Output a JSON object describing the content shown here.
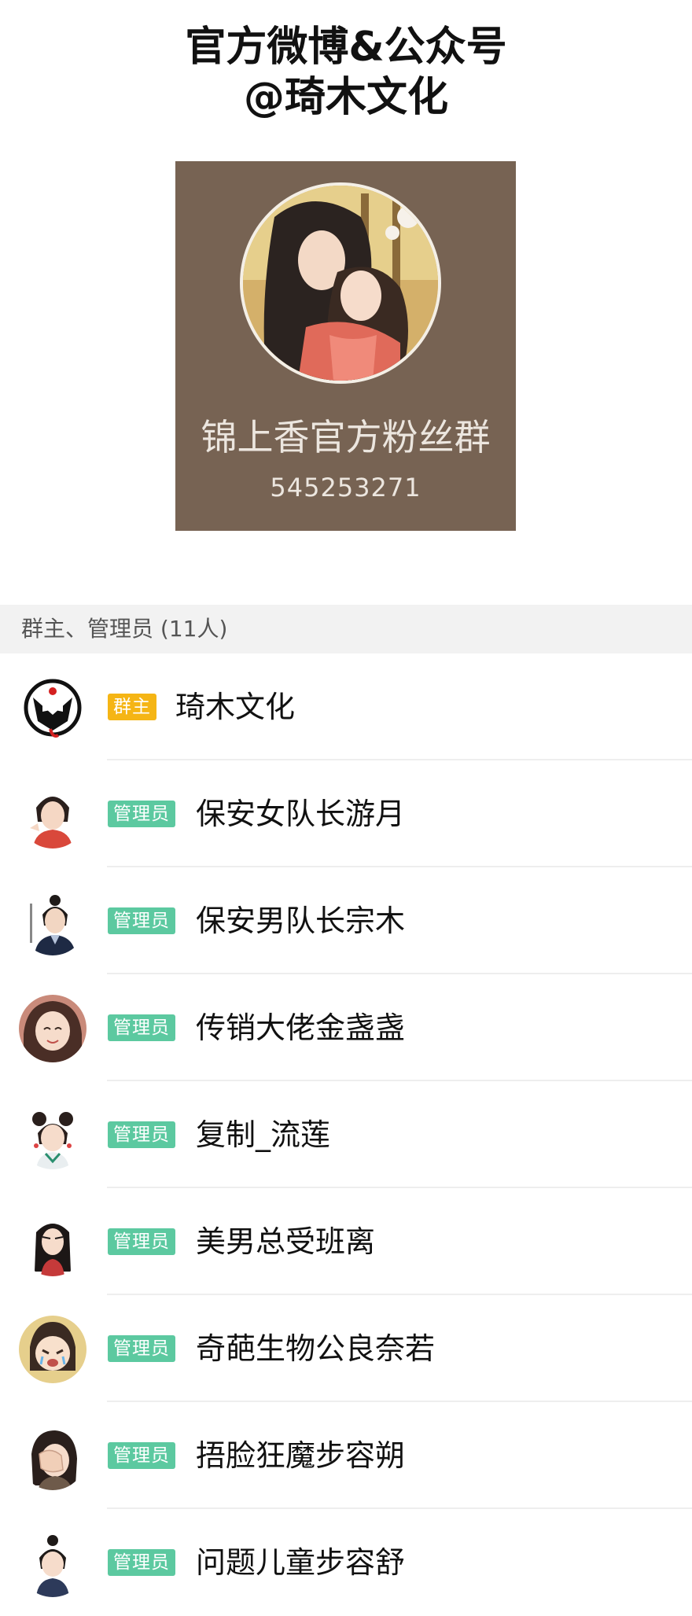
{
  "header": {
    "line1": "官方微博&公众号",
    "line2": "@琦木文化"
  },
  "group_card": {
    "name": "锦上香官方粉丝群",
    "number": "545253271",
    "background_color": "#776353"
  },
  "section": {
    "title": "群主、管理员 (11人)"
  },
  "members": [
    {
      "role": "群主",
      "role_type": "owner",
      "name": "琦木文化",
      "avatar": "opera-mask-logo"
    },
    {
      "role": "管理员",
      "role_type": "admin",
      "name": "保安女队长游月",
      "avatar": "girl-red-robe"
    },
    {
      "role": "管理员",
      "role_type": "admin",
      "name": "保安男队长宗木",
      "avatar": "man-dark-robe"
    },
    {
      "role": "管理员",
      "role_type": "admin",
      "name": "传销大佬金盏盏",
      "avatar": "smiling-woman"
    },
    {
      "role": "管理员",
      "role_type": "admin",
      "name": "复制_流莲",
      "avatar": "girl-buns"
    },
    {
      "role": "管理员",
      "role_type": "admin",
      "name": "美男总受班离",
      "avatar": "long-hair-man"
    },
    {
      "role": "管理员",
      "role_type": "admin",
      "name": "奇葩生物公良奈若",
      "avatar": "crying-girl"
    },
    {
      "role": "管理员",
      "role_type": "admin",
      "name": "捂脸狂魔步容朔",
      "avatar": "face-palm-man"
    },
    {
      "role": "管理员",
      "role_type": "admin",
      "name": "问题儿童步容舒",
      "avatar": "young-boy"
    }
  ],
  "colors": {
    "owner_badge": "#f5b515",
    "admin_badge": "#5cc9a0",
    "section_bar": "#f2f2f2"
  }
}
